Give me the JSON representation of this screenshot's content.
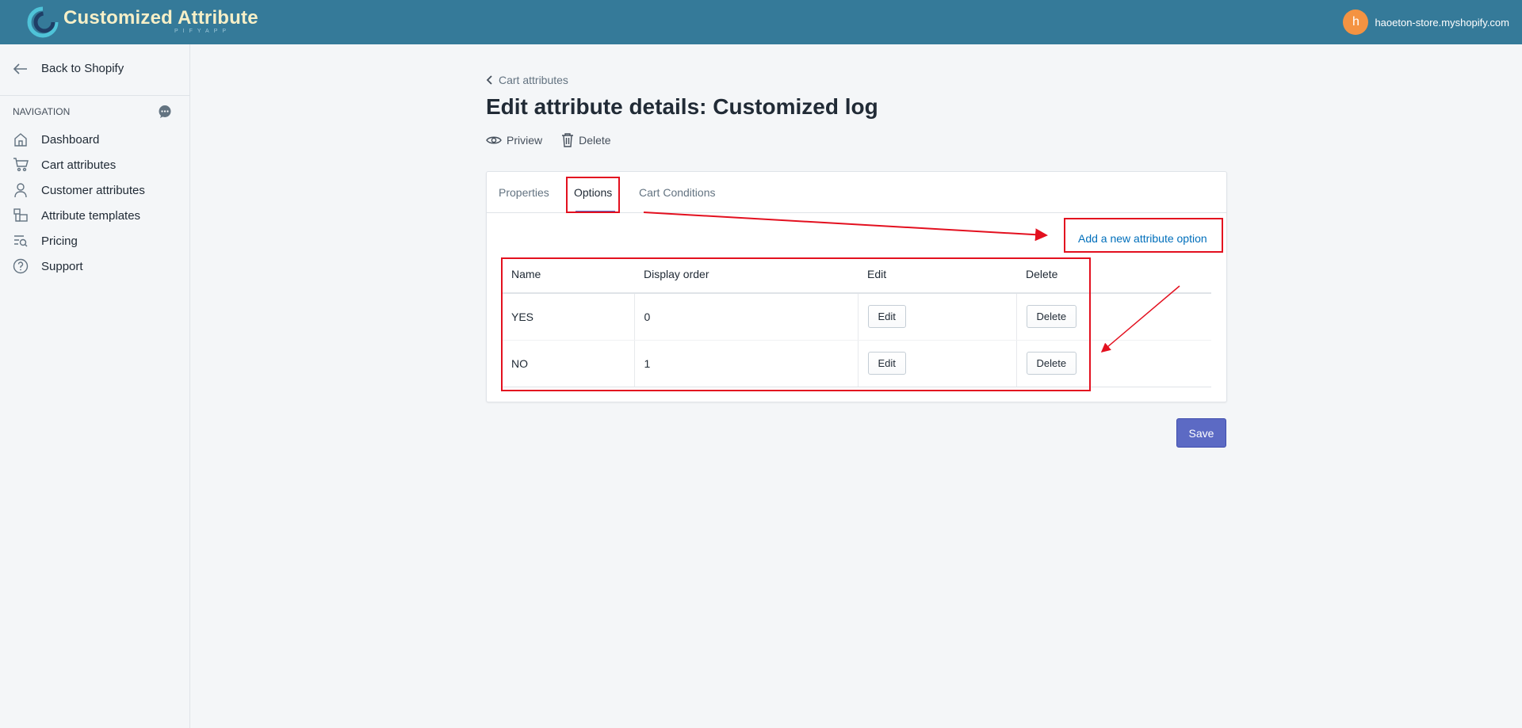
{
  "header": {
    "app_title": "Customized Attribute",
    "app_subtitle": "PIFYAPP",
    "user_initial": "h",
    "store_name": "haoeton-store.myshopify.com",
    "bar_color": "#357a99",
    "avatar_color": "#f49342"
  },
  "sidebar": {
    "back_label": "Back to Shopify",
    "nav_heading": "NAVIGATION",
    "items": [
      {
        "label": "Dashboard",
        "icon": "home-icon"
      },
      {
        "label": "Cart attributes",
        "icon": "cart-icon"
      },
      {
        "label": "Customer attributes",
        "icon": "person-icon"
      },
      {
        "label": "Attribute templates",
        "icon": "templates-icon"
      },
      {
        "label": "Pricing",
        "icon": "pricing-search-icon"
      },
      {
        "label": "Support",
        "icon": "help-circle-icon"
      }
    ]
  },
  "page": {
    "breadcrumb": "Cart attributes",
    "title": "Edit attribute details: Customized log",
    "actions": {
      "preview_label": "Priview",
      "delete_label": "Delete"
    },
    "tabs": [
      {
        "label": "Properties",
        "active": false
      },
      {
        "label": "Options",
        "active": true
      },
      {
        "label": "Cart Conditions",
        "active": false
      }
    ],
    "add_option_label": "Add a new attribute option",
    "table": {
      "headers": [
        "Name",
        "Display order",
        "Edit",
        "Delete"
      ],
      "rows": [
        {
          "name": "YES",
          "display_order": "0",
          "edit_label": "Edit",
          "delete_label": "Delete"
        },
        {
          "name": "NO",
          "display_order": "1",
          "edit_label": "Edit",
          "delete_label": "Delete"
        }
      ]
    },
    "save_label": "Save",
    "accent_color": "#5c6ac4",
    "annotation_color": "#e3101f"
  }
}
